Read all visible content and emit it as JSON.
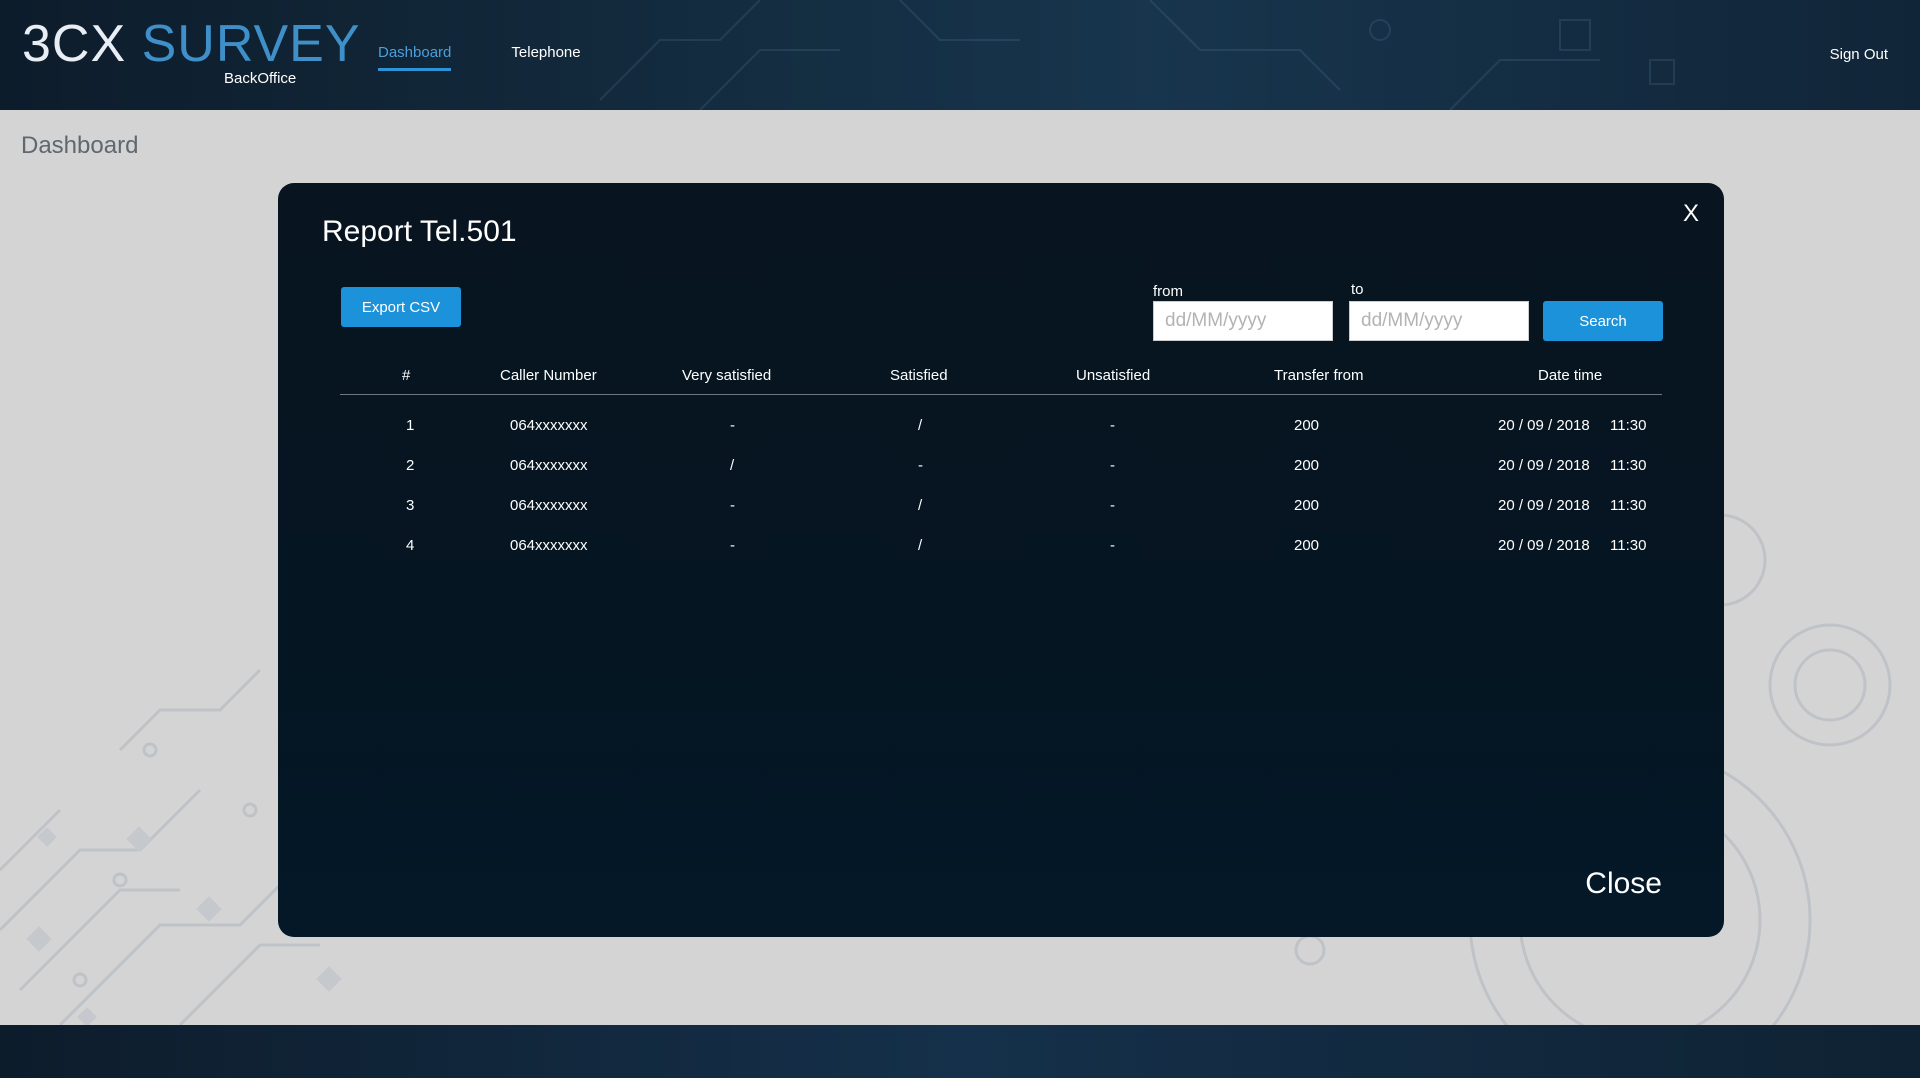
{
  "header": {
    "logo_3cx": "3CX",
    "logo_survey": "SURVEY",
    "logo_sub": "BackOffice",
    "nav": [
      {
        "label": "Dashboard",
        "active": true
      },
      {
        "label": "Telephone",
        "active": false
      }
    ],
    "signout": "Sign Out"
  },
  "page": {
    "title": "Dashboard"
  },
  "modal": {
    "x_label": "X",
    "title": "Report Tel.501",
    "export_label": "Export CSV",
    "from_label": "from",
    "to_label": "to",
    "from_placeholder": "dd/MM/yyyy",
    "to_placeholder": "dd/MM/yyyy",
    "search_label": "Search",
    "close_label": "Close",
    "table": {
      "headers": [
        "#",
        "Caller Number",
        "Very satisfied",
        "Satisfied",
        "Unsatisfied",
        "Transfer from",
        "Date time"
      ],
      "rows": [
        [
          "1",
          "064xxxxxxx",
          "-",
          "/",
          "-",
          "200",
          "20 / 09 / 2018",
          "11:30"
        ],
        [
          "2",
          "064xxxxxxx",
          "/",
          "-",
          "-",
          "200",
          "20 / 09 / 2018",
          "11:30"
        ],
        [
          "3",
          "064xxxxxxx",
          "-",
          "/",
          "-",
          "200",
          "20 / 09 / 2018",
          "11:30"
        ],
        [
          "4",
          "064xxxxxxx",
          "-",
          "/",
          "-",
          "200",
          "20 / 09 / 2018",
          "11:30"
        ]
      ]
    }
  },
  "colors": {
    "accent": "#1b92d9",
    "nav_active": "#4a9fdc",
    "modal_bg": "#051521",
    "header_bg": "#12293b"
  }
}
